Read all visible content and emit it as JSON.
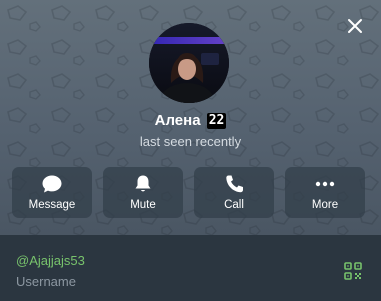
{
  "profile": {
    "name": "Алена",
    "name_badge": "22",
    "status": "last seen recently",
    "username": "@Ajajjajs53",
    "username_label": "Username"
  },
  "actions": [
    {
      "label": "Message",
      "icon": "message-icon"
    },
    {
      "label": "Mute",
      "icon": "bell-icon"
    },
    {
      "label": "Call",
      "icon": "phone-icon"
    },
    {
      "label": "More",
      "icon": "more-dots-icon"
    }
  ],
  "icons": {
    "close": "close-icon",
    "qr": "qr-code-icon"
  },
  "colors": {
    "header_background": "#5a6673",
    "info_background": "#2b3640",
    "username_accent": "#78c36c",
    "button_background": "#3a4652"
  }
}
